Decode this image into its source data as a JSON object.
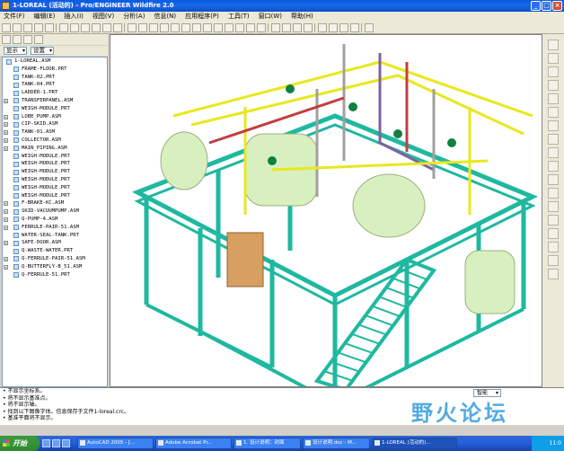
{
  "window": {
    "title": "1-LOREAL (活动的) - Pro/ENGINEER Wildfire 2.0",
    "controls": [
      "_",
      "□",
      "×"
    ]
  },
  "menu": [
    "文件(F)",
    "编辑(E)",
    "插入(I)",
    "视图(V)",
    "分析(A)",
    "信息(N)",
    "应用程序(P)",
    "工具(T)",
    "窗口(W)",
    "帮助(H)"
  ],
  "model_tree": {
    "show_label": "显示",
    "settings_label": "设置",
    "items": [
      {
        "label": "1-LOREAL.ASM",
        "level": 0,
        "expandable": false
      },
      {
        "label": "FRAME-FLOOR.PRT",
        "level": 1,
        "expandable": false
      },
      {
        "label": "TANK-02.PRT",
        "level": 1,
        "expandable": false
      },
      {
        "label": "TANK-04.PRT",
        "level": 1,
        "expandable": false
      },
      {
        "label": "LADDER-1.PRT",
        "level": 1,
        "expandable": false
      },
      {
        "label": "TRANSFERPANEL.ASM",
        "level": 1,
        "expandable": true
      },
      {
        "label": "WEIGH-MODULE.PRT",
        "level": 1,
        "expandable": false
      },
      {
        "label": "LOBE_PUMP.ASM",
        "level": 1,
        "expandable": true
      },
      {
        "label": "CIP-SKID.ASM",
        "level": 1,
        "expandable": true
      },
      {
        "label": "TANK-01.ASM",
        "level": 1,
        "expandable": true
      },
      {
        "label": "COLLECTOR.ASM",
        "level": 1,
        "expandable": true
      },
      {
        "label": "MAIN_PIPING.ASM",
        "level": 1,
        "expandable": true
      },
      {
        "label": "WEIGH-MODULE.PRT",
        "level": 1,
        "expandable": false
      },
      {
        "label": "WEIGH-MODULE.PRT",
        "level": 1,
        "expandable": false
      },
      {
        "label": "WEIGH-MODULE.PRT",
        "level": 1,
        "expandable": false
      },
      {
        "label": "WEIGH-MODULE.PRT",
        "level": 1,
        "expandable": false
      },
      {
        "label": "WEIGH-MODULE.PRT",
        "level": 1,
        "expandable": false
      },
      {
        "label": "WEIGH-MODULE.PRT",
        "level": 1,
        "expandable": false
      },
      {
        "label": "F-BRAKE-KC.ASM",
        "level": 1,
        "expandable": true
      },
      {
        "label": "SKID-VACUUMPUMP.ASM",
        "level": 1,
        "expandable": true
      },
      {
        "label": "Q-PUMP-4.ASM",
        "level": 1,
        "expandable": true
      },
      {
        "label": "FERRULE-PAIR-51.ASM",
        "level": 1,
        "expandable": true
      },
      {
        "label": "WATER-SEAL-TANK.PRT",
        "level": 1,
        "expandable": false
      },
      {
        "label": "SAFE-DOOR.ASM",
        "level": 1,
        "expandable": true
      },
      {
        "label": "Q-WASTE-WATER.PRT",
        "level": 1,
        "expandable": false
      },
      {
        "label": "Q-FERRULE-PAIR-51.ASM",
        "level": 1,
        "expandable": true
      },
      {
        "label": "Q-BUTTERFLY-B_51.ASM",
        "level": 1,
        "expandable": true
      },
      {
        "label": "Q-FERRULE-51.PRT",
        "level": 1,
        "expandable": false
      }
    ]
  },
  "messages": [
    "• 不显示坐标系。",
    "• 将不显示基准点。",
    "• 将不显示轴。",
    "• 找到以下图像字体。信息保存于文件1-loreal.crc。",
    "• 基准平面将不显示。"
  ],
  "filter_label": "智能",
  "watermark": "野火论坛",
  "taskbar": {
    "start_label": "开始",
    "tasks": [
      {
        "label": "AutoCAD 2005 - [...",
        "active": false
      },
      {
        "label": "Adobe Acrobat Pr...",
        "active": false
      },
      {
        "label": "1. 设计说明：封面",
        "active": false
      },
      {
        "label": "设计说明.doc - M...",
        "active": false
      },
      {
        "label": "1-LOREAL (活动的)...",
        "active": true
      }
    ],
    "clock": "11:0"
  },
  "colors": {
    "frame": "#1fb8a0",
    "pipe_yellow": "#e8e820",
    "tank": "#d8f0c0",
    "valve": "#108040",
    "pipe_grey": "#a0a0a0",
    "pipe_purple": "#8060a0",
    "pipe_red": "#c04040"
  }
}
